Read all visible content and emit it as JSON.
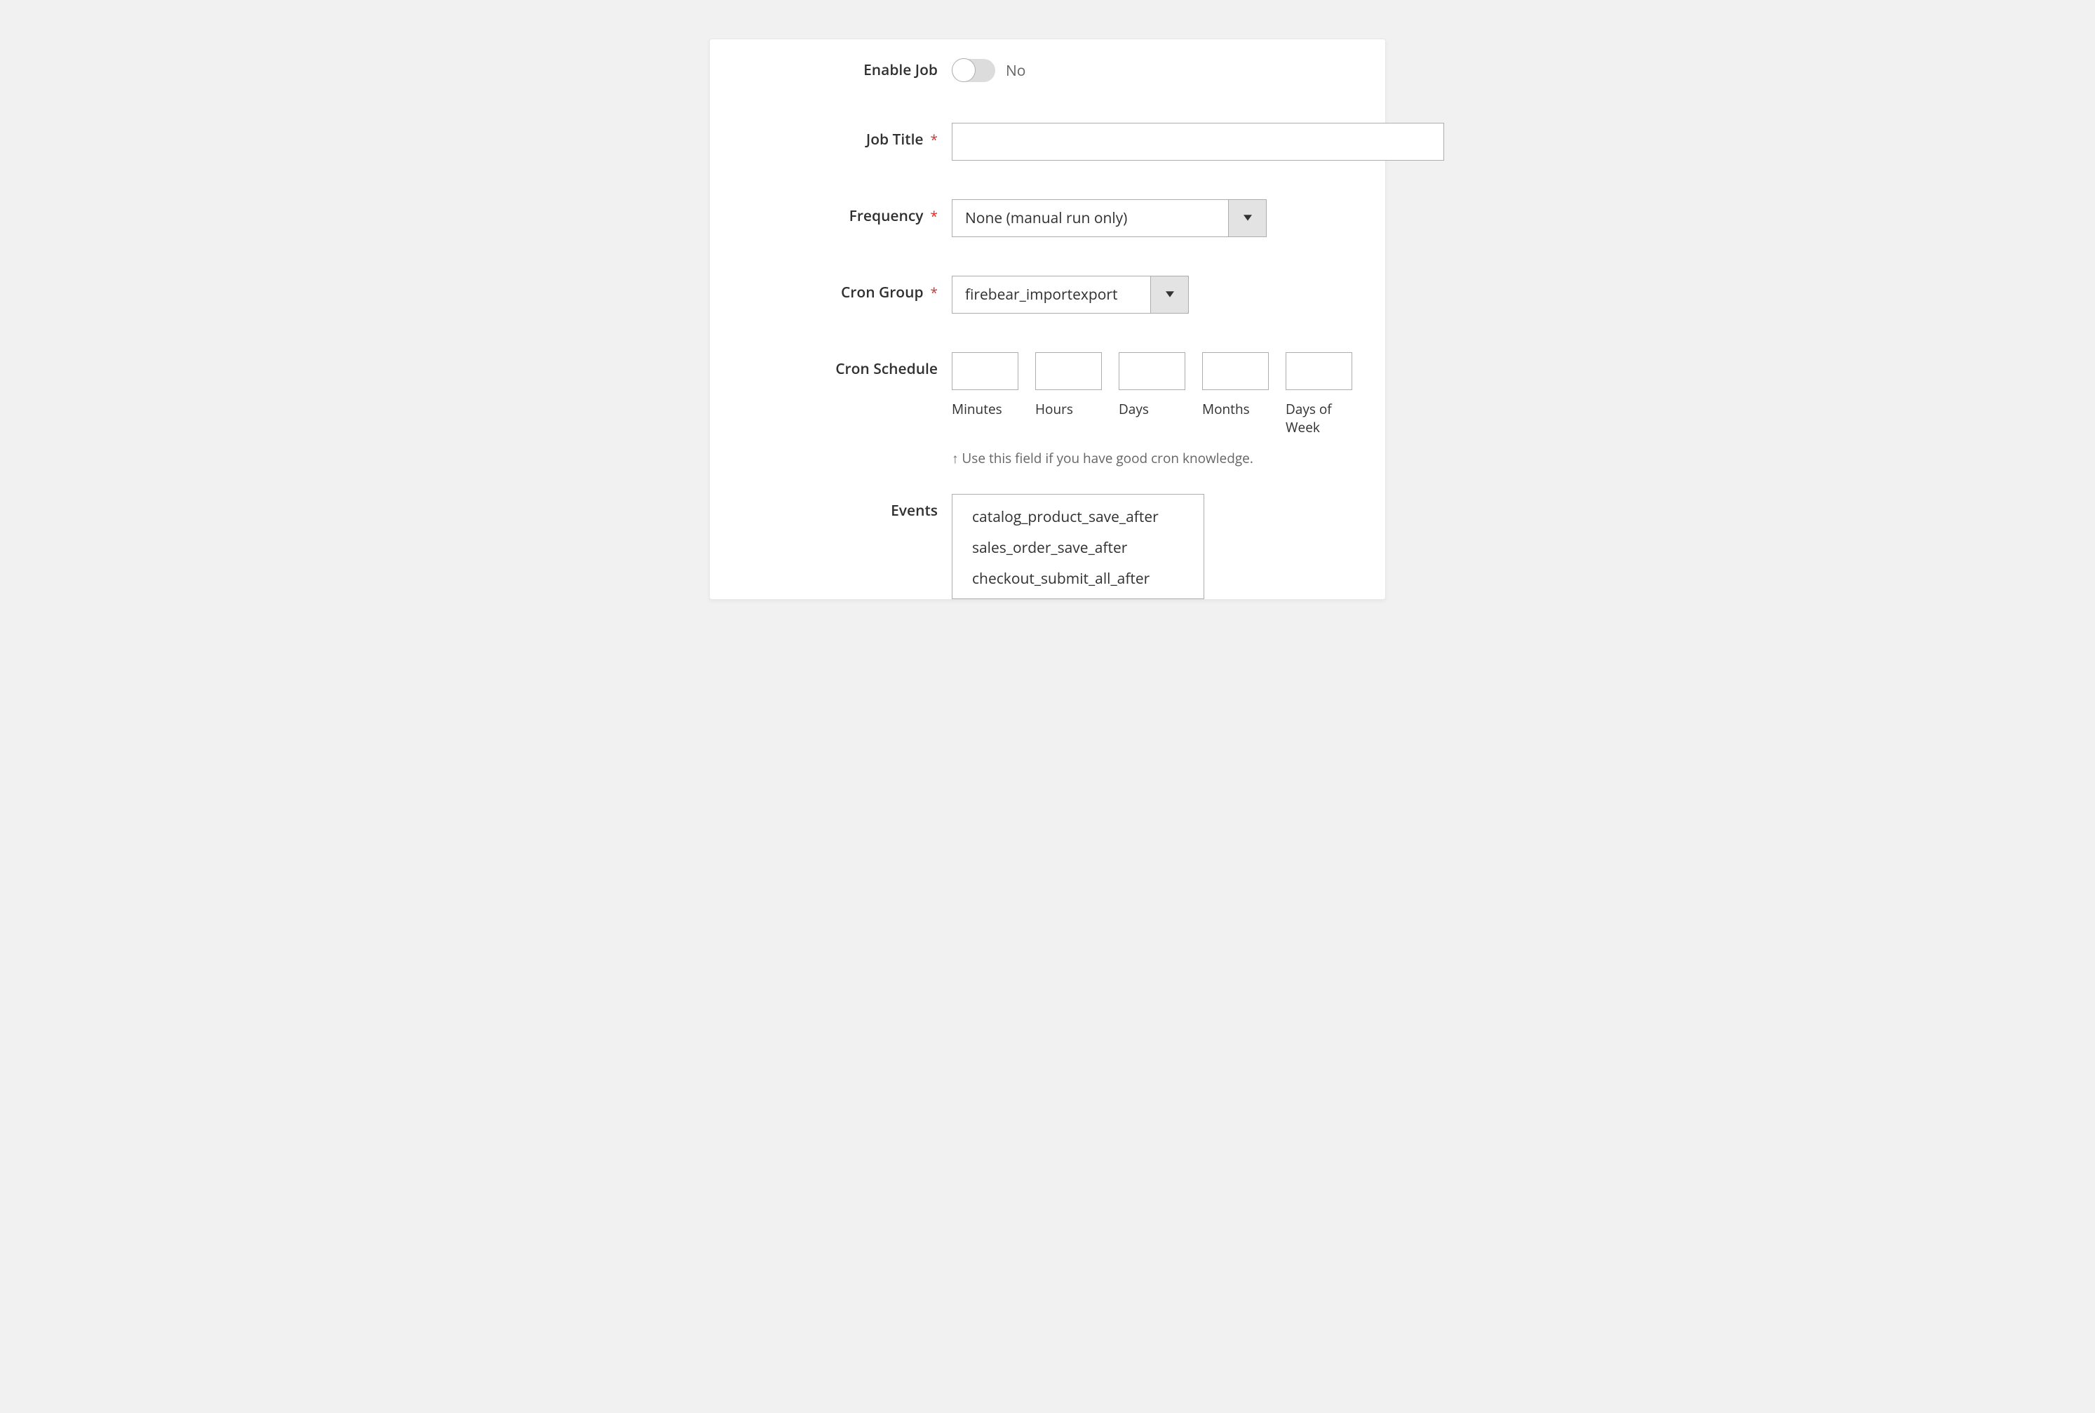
{
  "fields": {
    "enable_job": {
      "label": "Enable Job",
      "state": false,
      "state_label": "No"
    },
    "job_title": {
      "label": "Job Title",
      "value": ""
    },
    "frequency": {
      "label": "Frequency",
      "selected": "None (manual run only)"
    },
    "cron_group": {
      "label": "Cron Group",
      "selected": "firebear_importexport"
    },
    "cron_schedule": {
      "label": "Cron Schedule",
      "parts": [
        {
          "value": "",
          "caption": "Minutes"
        },
        {
          "value": "",
          "caption": "Hours"
        },
        {
          "value": "",
          "caption": "Days"
        },
        {
          "value": "",
          "caption": "Months"
        },
        {
          "value": "",
          "caption": "Days of Week"
        }
      ],
      "helper": "↑ Use this field if you have good cron knowledge."
    },
    "events": {
      "label": "Events",
      "options": [
        "catalog_product_save_after",
        "sales_order_save_after",
        "checkout_submit_all_after"
      ]
    }
  }
}
